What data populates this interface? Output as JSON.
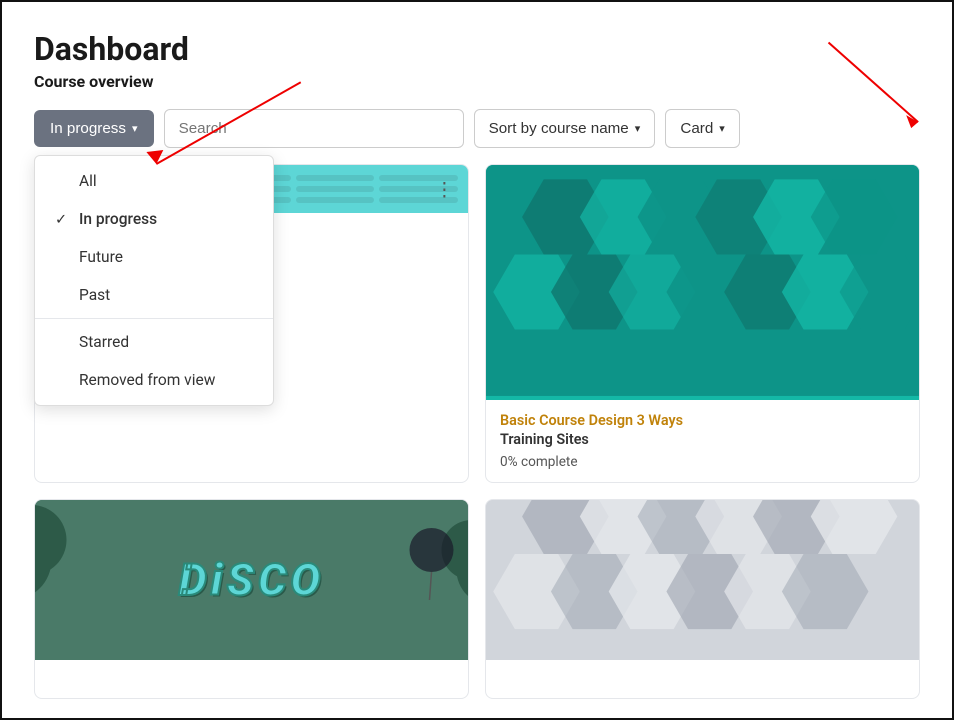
{
  "page": {
    "title": "Dashboard",
    "subtitle": "Course overview"
  },
  "toolbar": {
    "progress_button": "In progress",
    "search_placeholder": "Search",
    "sort_label": "Sort by course name",
    "card_label": "Card"
  },
  "dropdown": {
    "items": [
      {
        "id": "all",
        "label": "All",
        "checked": false
      },
      {
        "id": "in-progress",
        "label": "In progress",
        "checked": true
      },
      {
        "id": "future",
        "label": "Future",
        "checked": false
      },
      {
        "id": "past",
        "label": "Past",
        "checked": false
      },
      {
        "id": "starred",
        "label": "Starred",
        "checked": false
      },
      {
        "id": "removed",
        "label": "Removed from view",
        "checked": false
      }
    ]
  },
  "cards": [
    {
      "id": "card1",
      "type": "teal-pattern",
      "title": "",
      "subtitle": "",
      "progress": ""
    },
    {
      "id": "card2",
      "type": "green-hex",
      "title": "Basic Course Design 3 Ways",
      "subtitle": "Training Sites",
      "progress": "0% complete"
    },
    {
      "id": "card3",
      "type": "disco",
      "title": "",
      "subtitle": "",
      "progress": ""
    },
    {
      "id": "card4",
      "type": "gray-hex",
      "title": "",
      "subtitle": "",
      "progress": ""
    }
  ]
}
